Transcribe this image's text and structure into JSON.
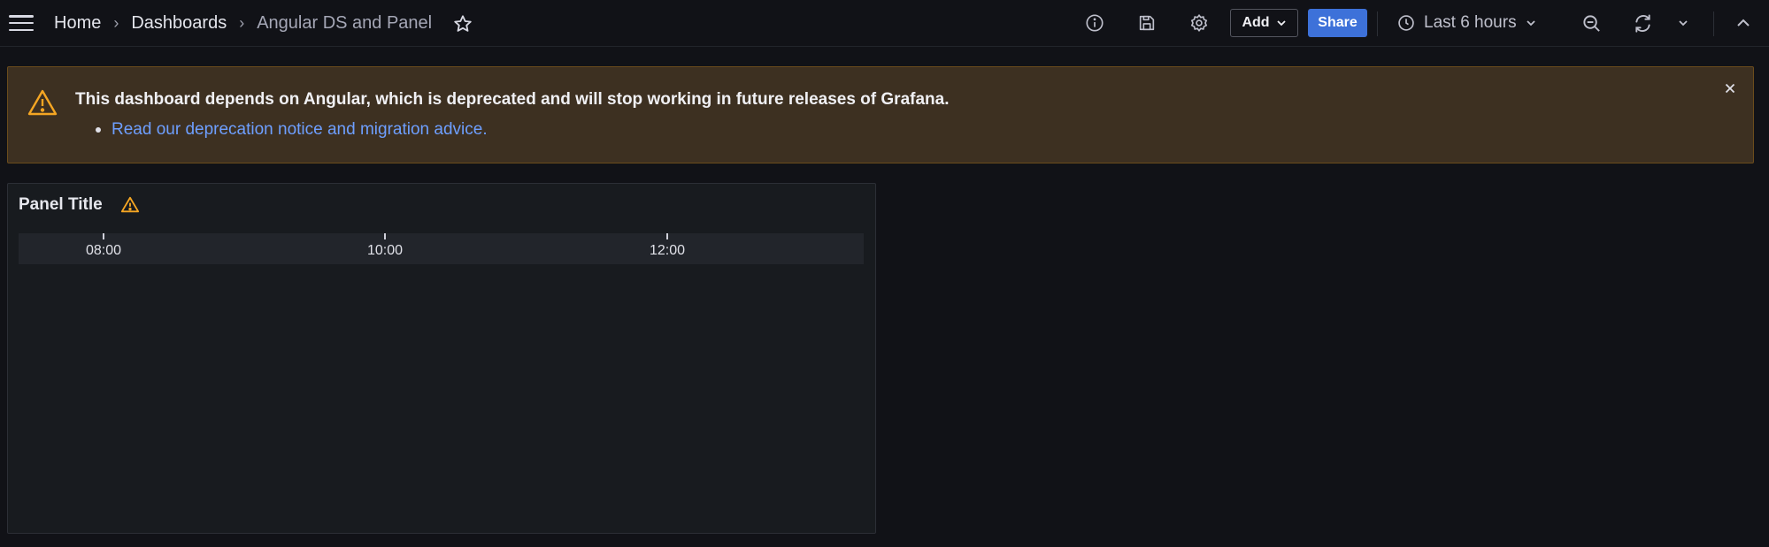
{
  "nav": {
    "breadcrumbs": [
      "Home",
      "Dashboards",
      "Angular DS and Panel"
    ],
    "separator": "›"
  },
  "toolbar": {
    "add_label": "Add",
    "share_label": "Share",
    "time_range": "Last 6 hours",
    "icons": [
      "menu-icon",
      "star-icon",
      "info-icon",
      "save-icon",
      "settings-icon",
      "zoom-out-icon",
      "refresh-icon",
      "collapse-icon"
    ]
  },
  "banner": {
    "message": "This dashboard depends on Angular, which is deprecated and will stop working in future releases of Grafana.",
    "link_text": "Read our deprecation notice and migration advice.",
    "colors": {
      "background": "#3d3021",
      "border": "#6b4c1c",
      "warning": "#f5a623",
      "link": "#6e9fff"
    }
  },
  "panel": {
    "title": "Panel Title",
    "x_ticks": [
      "08:00",
      "10:00",
      "12:00"
    ]
  },
  "colors": {
    "background": "#111217",
    "panel": "#181b1f",
    "primary": "#3d71d9"
  }
}
